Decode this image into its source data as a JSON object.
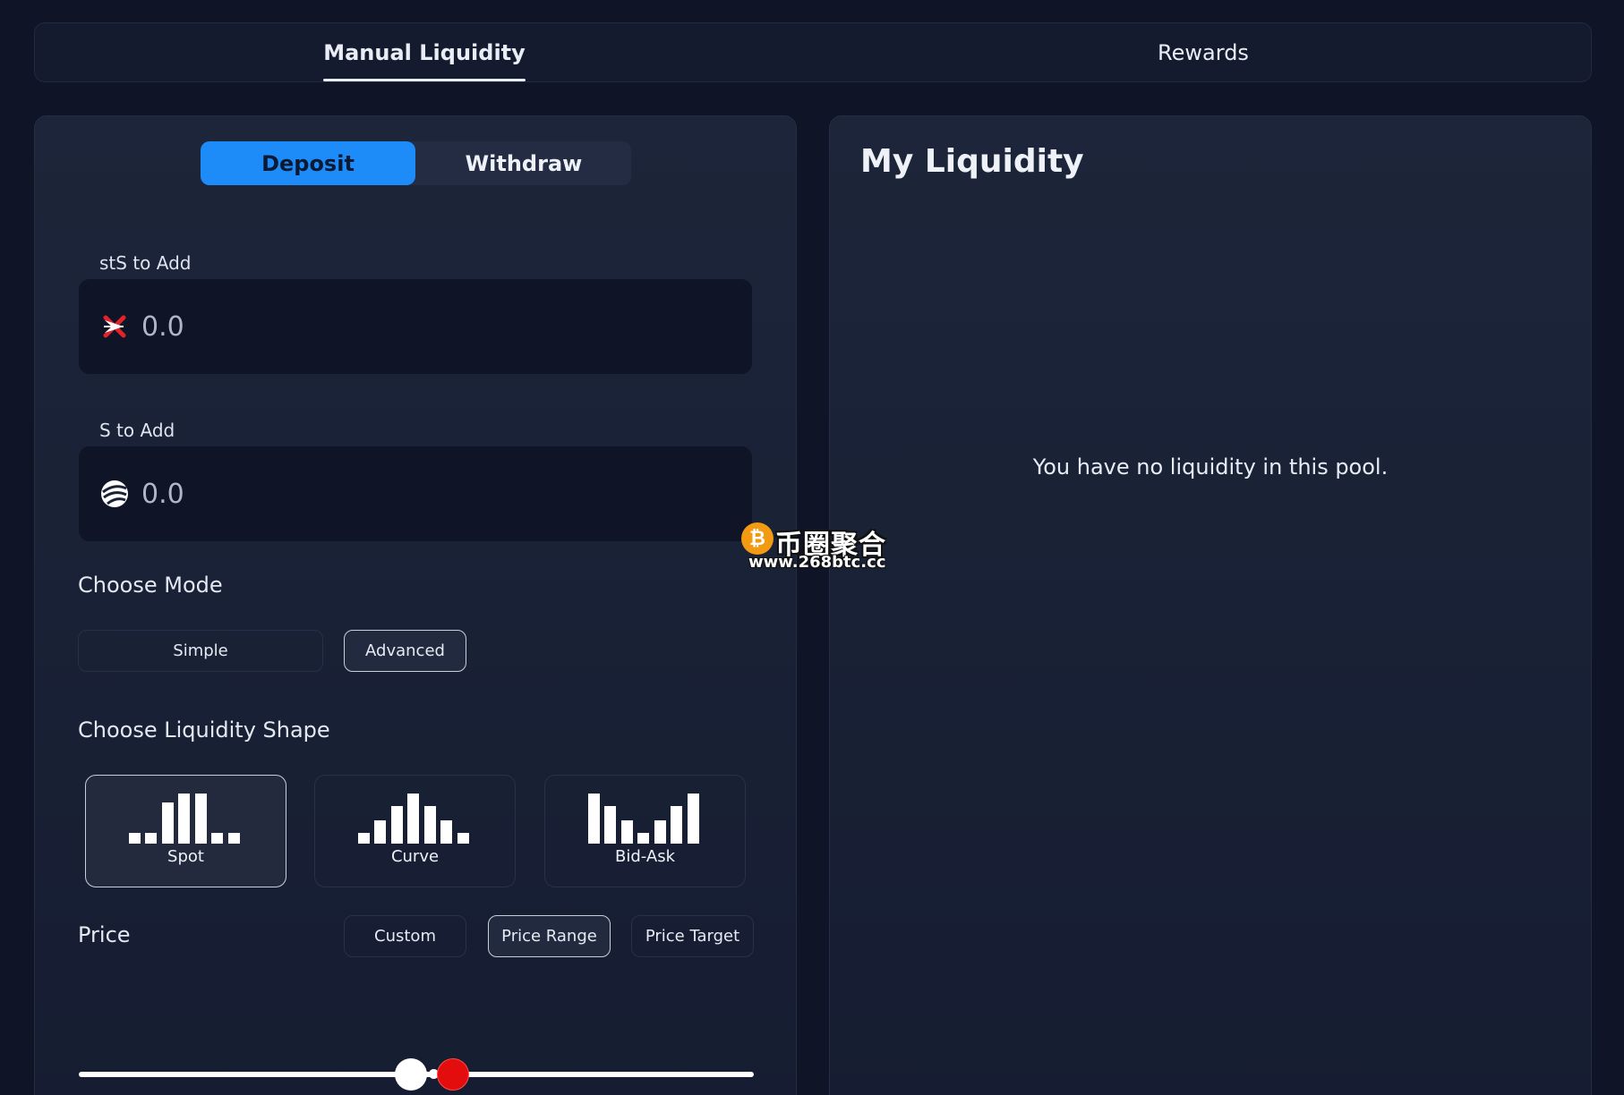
{
  "tabs": [
    {
      "label": "Manual Liquidity",
      "active": true
    },
    {
      "label": "Rewards",
      "active": false
    }
  ],
  "action_toggle": {
    "deposit_label": "Deposit",
    "withdraw_label": "Withdraw",
    "selected": "Deposit",
    "accent_color": "#1d8cf8"
  },
  "inputs": {
    "token_a": {
      "label": "stS to Add",
      "placeholder": "0.0",
      "value": "",
      "icon": "sts-token-icon"
    },
    "token_b": {
      "label": "S to Add",
      "placeholder": "0.0",
      "value": "",
      "icon": "s-token-icon"
    }
  },
  "mode": {
    "title": "Choose Mode",
    "options": [
      "Simple",
      "Advanced"
    ],
    "selected": "Advanced"
  },
  "shape": {
    "title": "Choose Liquidity Shape",
    "options": [
      "Spot",
      "Curve",
      "Bid-Ask"
    ],
    "selected": "Spot"
  },
  "price": {
    "title": "Price",
    "options": [
      "Custom",
      "Price Range",
      "Price Target"
    ],
    "selected": "Price Range"
  },
  "slider": {
    "handle_colors": {
      "lower": "#ffffff",
      "upper": "#e30d0d"
    }
  },
  "my_liquidity": {
    "title": "My Liquidity",
    "empty_message": "You have no liquidity in this pool."
  },
  "watermark": {
    "name": "币圈聚合",
    "url": "www.268btc.cc",
    "coin_symbol": "₿"
  }
}
